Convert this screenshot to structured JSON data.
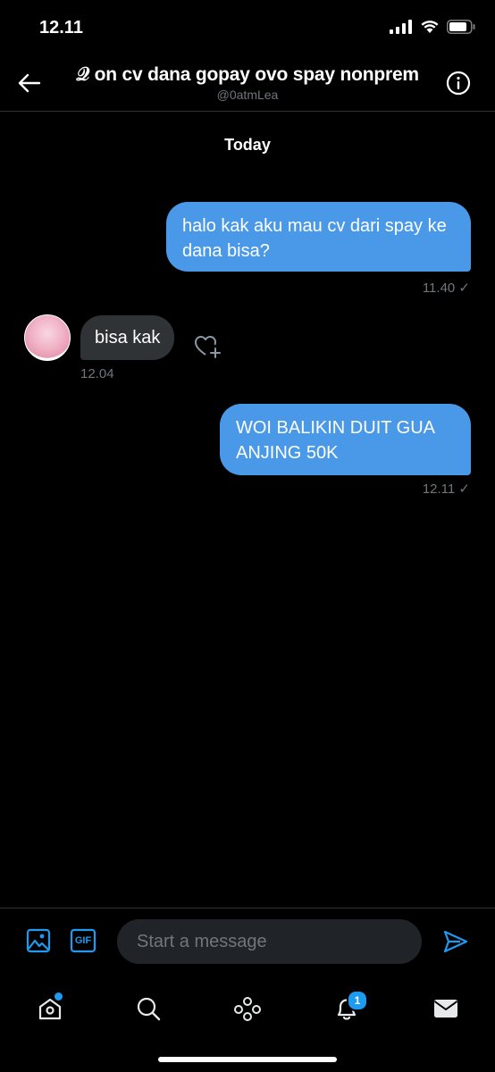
{
  "status_bar": {
    "time": "12.11"
  },
  "header": {
    "title": "𝒬 on cv dana gopay ovo spay nonprem",
    "handle": "@0atmLea"
  },
  "conversation": {
    "day_label": "Today",
    "messages": [
      {
        "direction": "outgoing",
        "text": "halo kak aku mau cv dari spay ke dana bisa?",
        "time": "11.40 ✓"
      },
      {
        "direction": "incoming",
        "text": "bisa kak",
        "time": "12.04"
      },
      {
        "direction": "outgoing",
        "text": "WOI BALIKIN DUIT GUA ANJING 50K",
        "time": "12.11 ✓"
      }
    ]
  },
  "composer": {
    "placeholder": "Start a message",
    "gif_label": "GIF"
  },
  "tab_bar": {
    "notification_count": "1"
  },
  "colors": {
    "accent": "#1d9bf0",
    "outgoing_bubble": "#4a99e9",
    "incoming_bubble": "#2f3336",
    "background": "#000000"
  },
  "icons": [
    "back-arrow-icon",
    "info-icon",
    "heart-plus-icon",
    "image-icon",
    "gif-icon",
    "send-icon",
    "home-icon",
    "search-icon",
    "spaces-icon",
    "bell-icon",
    "mail-icon"
  ]
}
